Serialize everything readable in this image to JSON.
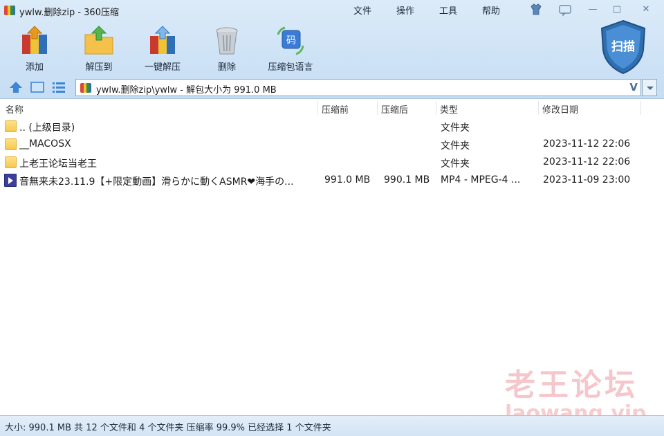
{
  "window": {
    "title": "ywlw.删除zip - 360压缩",
    "menu": [
      "文件",
      "操作",
      "工具",
      "帮助"
    ],
    "controls": {
      "minimize": "—",
      "maximize": "□",
      "close": "✕"
    }
  },
  "toolbar": {
    "items": [
      {
        "label": "添加",
        "icon": "add-archive-icon"
      },
      {
        "label": "解压到",
        "icon": "extract-to-icon"
      },
      {
        "label": "一键解压",
        "icon": "one-click-extract-icon"
      },
      {
        "label": "删除",
        "icon": "delete-trash-icon"
      },
      {
        "label": "压缩包语言",
        "icon": "archive-language-icon"
      }
    ],
    "scan_label": "扫描"
  },
  "address": {
    "path": "ywlw.删除zip\\ywlw - 解包大小为 991.0 MB",
    "toggle": "V"
  },
  "columns": [
    "名称",
    "压缩前",
    "压缩后",
    "类型",
    "修改日期"
  ],
  "rows": [
    {
      "name": ".. (上级目录)",
      "before": "",
      "after": "",
      "type": "文件夹",
      "date": "",
      "icon": "folder-icon"
    },
    {
      "name": "__MACOSX",
      "before": "",
      "after": "",
      "type": "文件夹",
      "date": "2023-11-12 22:06",
      "icon": "folder-icon"
    },
    {
      "name": "上老王论坛当老王",
      "before": "",
      "after": "",
      "type": "文件夹",
      "date": "2023-11-12 22:06",
      "icon": "folder-icon"
    },
    {
      "name": "音無来未23.11.9【+限定動画】滑らかに動くASMR❤海手の...",
      "before": "991.0 MB",
      "after": "990.1 MB",
      "type": "MP4 - MPEG-4 ...",
      "date": "2023-11-09 23:00",
      "icon": "video-file-icon"
    }
  ],
  "status": "大小: 990.1 MB 共 12 个文件和 4 个文件夹 压缩率 99.9% 已经选择 1 个文件夹",
  "watermark": {
    "cn": "老王论坛",
    "en": "laowang.vip"
  }
}
